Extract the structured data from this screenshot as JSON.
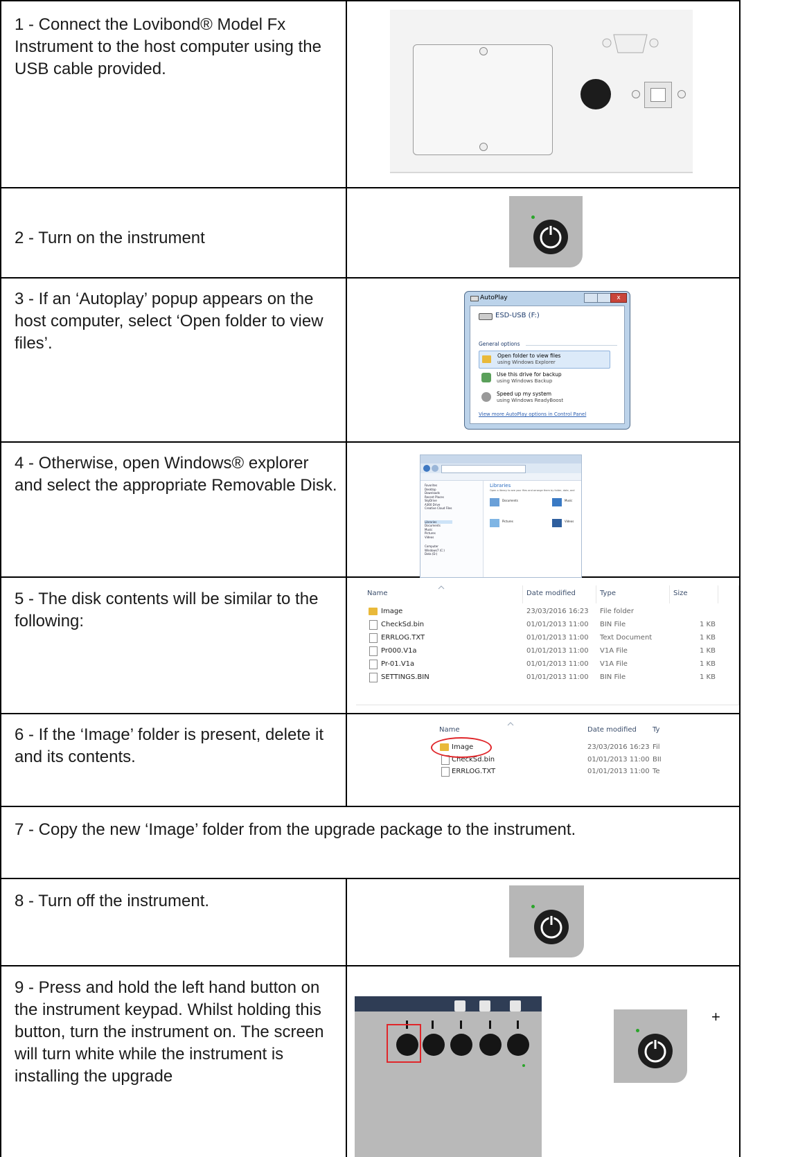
{
  "steps": {
    "s1": "1 - Connect the Lovibond® Model Fx Instrument to the host computer using the USB cable provided.",
    "s2": "2 - Turn on the instrument",
    "s3": "3 - If an ‘Autoplay’ popup appears on the host computer, select ‘Open folder to view files’.",
    "s4": "4 - Otherwise, open Windows® explorer and select the appropriate Removable Disk.",
    "s5": "5 - The disk contents will be similar to the following:",
    "s6": "6 - If the ‘Image’ folder is present, delete it and its contents.",
    "s7": "7 - Copy the new ‘Image’ folder from the upgrade package to the instrument.",
    "s8": "8 - Turn off the instrument.",
    "s9": "9 - Press and hold the left hand button on the instrument keypad. Whilst holding this button, turn the instrument on. The screen will turn white while the instrument is installing the upgrade"
  },
  "plus_sign": "+",
  "autoplay": {
    "title": "AutoPlay",
    "drive": "ESD-USB (F:)",
    "section": "General options",
    "options": [
      {
        "title": "Open folder to view files",
        "sub": "using Windows Explorer"
      },
      {
        "title": "Use this drive for backup",
        "sub": "using Windows Backup"
      },
      {
        "title": "Speed up my system",
        "sub": "using Windows ReadyBoost"
      }
    ],
    "link": "View more AutoPlay options in Control Panel"
  },
  "explorer": {
    "libraries": "Libraries",
    "libraries_sub": "Open a library to see your files and arrange them by folder, date, and",
    "nav": [
      "Favorites",
      "Desktop",
      "Downloads",
      "Recent Places",
      "SkyDrive",
      "A360 Drive",
      "Creative Cloud Files",
      "Libraries",
      "Documents",
      "Music",
      "Pictures",
      "Videos",
      "Computer",
      "Windows7 (C:)",
      "Data (D:)"
    ],
    "items": [
      "Documents",
      "Music",
      "Pictures",
      "Videos"
    ],
    "item_sub": "Library"
  },
  "file_list": {
    "headers": [
      "Name",
      "Date modified",
      "Type",
      "Size"
    ],
    "rows": [
      {
        "name": "Image",
        "date": "23/03/2016 16:23",
        "type": "File folder",
        "size": ""
      },
      {
        "name": "CheckSd.bin",
        "date": "01/01/2013 11:00",
        "type": "BIN File",
        "size": "1 KB"
      },
      {
        "name": "ERRLOG.TXT",
        "date": "01/01/2013 11:00",
        "type": "Text Document",
        "size": "1 KB"
      },
      {
        "name": "Pr000.V1a",
        "date": "01/01/2013 11:00",
        "type": "V1A File",
        "size": "1 KB"
      },
      {
        "name": "Pr-01.V1a",
        "date": "01/01/2013 11:00",
        "type": "V1A File",
        "size": "1 KB"
      },
      {
        "name": "SETTINGS.BIN",
        "date": "01/01/2013 11:00",
        "type": "BIN File",
        "size": "1 KB"
      }
    ]
  },
  "file_list_small": {
    "headers": [
      "Name",
      "Date modified",
      "Ty"
    ],
    "rows": [
      {
        "name": "Image",
        "date": "23/03/2016 16:23",
        "type": "Fil"
      },
      {
        "name": "CheckSd.bin",
        "date": "01/01/2013 11:00",
        "type": "BII"
      },
      {
        "name": "ERRLOG.TXT",
        "date": "01/01/2013 11:00",
        "type": "Te"
      }
    ]
  }
}
